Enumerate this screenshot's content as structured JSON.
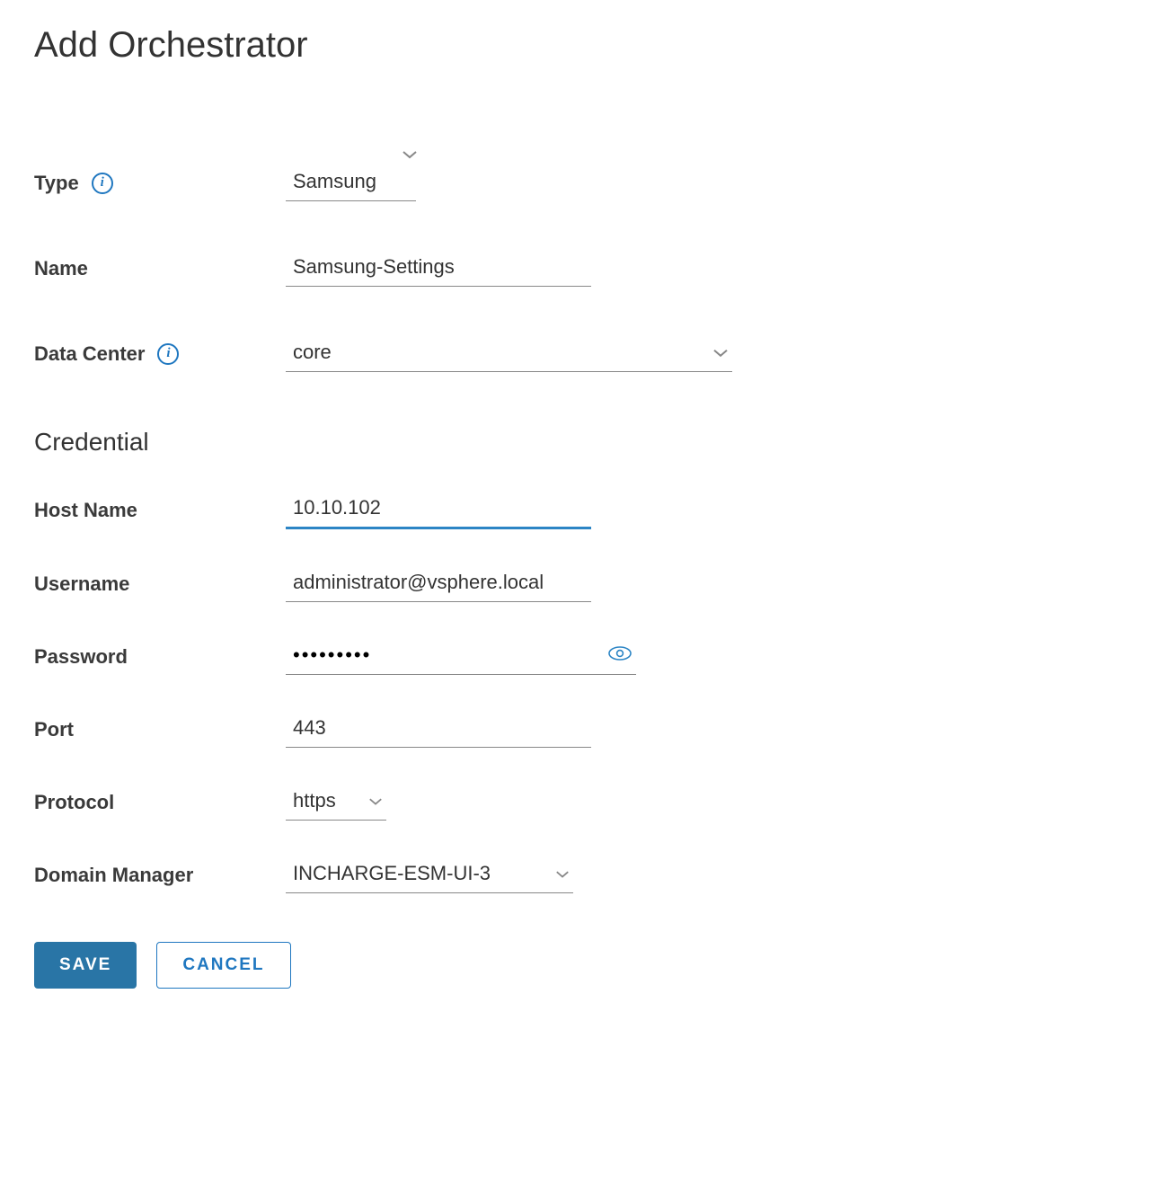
{
  "page_title": "Add Orchestrator",
  "section_credential": "Credential",
  "fields": {
    "type": {
      "label": "Type",
      "value": "Samsung"
    },
    "name": {
      "label": "Name",
      "value": "Samsung-Settings"
    },
    "data_center": {
      "label": "Data Center",
      "value": "core"
    },
    "host_name": {
      "label": "Host Name",
      "value": "10.10.102"
    },
    "username": {
      "label": "Username",
      "value": "administrator@vsphere.local"
    },
    "password": {
      "label": "Password",
      "value": "•••••••••"
    },
    "port": {
      "label": "Port",
      "value": "443"
    },
    "protocol": {
      "label": "Protocol",
      "value": "https"
    },
    "domain_mgr": {
      "label": "Domain Manager",
      "value": "INCHARGE-ESM-UI-3"
    }
  },
  "buttons": {
    "save": "Save",
    "cancel": "Cancel"
  }
}
